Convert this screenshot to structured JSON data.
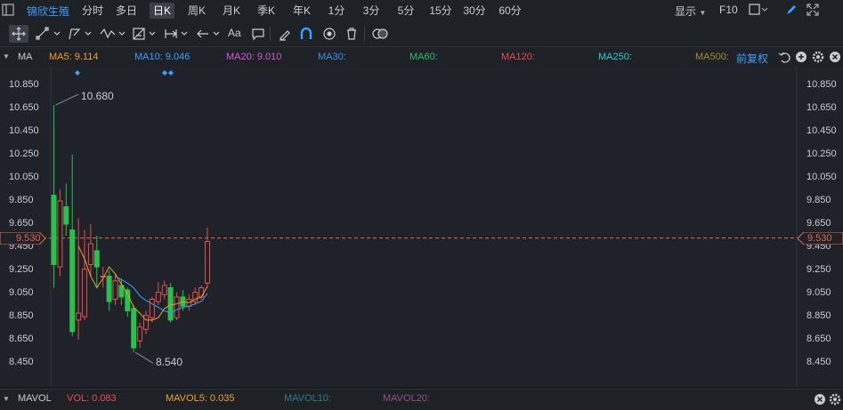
{
  "header": {
    "stock_name": "锦欣生殖",
    "periods": [
      "分时",
      "多日",
      "日K",
      "周K",
      "月K",
      "季K",
      "年K",
      "1分",
      "3分",
      "5分",
      "15分",
      "30分",
      "60分"
    ],
    "active_period": "日K",
    "display_label": "显示",
    "f10_label": "F10"
  },
  "ma_bar": {
    "indicator": "MA",
    "ma5": "MA5: 9.114",
    "ma10": "MA10: 9.046",
    "ma20": "MA20: 9.010",
    "ma30": "MA30:",
    "ma60": "MA60:",
    "ma120": "MA120:",
    "ma250": "MA250:",
    "ma500": "MA500:",
    "adjust": "前复权"
  },
  "colors": {
    "up": "#e84c4c",
    "down": "#27c24c",
    "ma5": "#f0a020",
    "ma10": "#3aa0ff",
    "ma20": "#d05cd0",
    "ma30": "#3a8fe0",
    "ma60": "#2dbe6c",
    "ma120": "#e84c4c",
    "ma250": "#20d0d0",
    "ma500": "#a08a3a",
    "current": "#e06a4a",
    "accent": "#3aa0ff"
  },
  "y_axis": {
    "ticks": [
      "10.850",
      "10.650",
      "10.450",
      "10.250",
      "10.050",
      "9.850",
      "9.650",
      "9.450",
      "9.250",
      "9.050",
      "8.850",
      "8.650",
      "8.450"
    ],
    "current_price": "9.530"
  },
  "annotations": {
    "high": "10.680",
    "low": "8.540"
  },
  "chart_data": {
    "type": "candlestick",
    "ylim": [
      8.35,
      10.93
    ],
    "current_price": 9.53,
    "high": 10.68,
    "low": 8.54,
    "candles": [
      {
        "o": 9.9,
        "c": 9.3,
        "h": 10.68,
        "l": 9.1
      },
      {
        "o": 9.28,
        "c": 9.85,
        "h": 9.95,
        "l": 9.2
      },
      {
        "o": 9.8,
        "c": 9.65,
        "h": 10.0,
        "l": 9.55
      },
      {
        "o": 9.6,
        "c": 8.72,
        "h": 10.25,
        "l": 8.68
      },
      {
        "o": 8.82,
        "c": 8.88,
        "h": 9.7,
        "l": 8.65
      },
      {
        "o": 8.85,
        "c": 9.26,
        "h": 9.6,
        "l": 8.82
      },
      {
        "o": 9.3,
        "c": 9.48,
        "h": 9.65,
        "l": 9.2
      },
      {
        "o": 9.42,
        "c": 9.28,
        "h": 9.55,
        "l": 9.1
      },
      {
        "o": 9.2,
        "c": 9.2,
        "h": 9.28,
        "l": 9.1
      },
      {
        "o": 9.2,
        "c": 8.98,
        "h": 9.25,
        "l": 8.9
      },
      {
        "o": 9.0,
        "c": 9.16,
        "h": 9.22,
        "l": 8.95
      },
      {
        "o": 9.12,
        "c": 9.02,
        "h": 9.18,
        "l": 8.95
      },
      {
        "o": 9.08,
        "c": 8.9,
        "h": 9.1,
        "l": 8.85
      },
      {
        "o": 8.92,
        "c": 8.58,
        "h": 8.95,
        "l": 8.54
      },
      {
        "o": 8.64,
        "c": 8.76,
        "h": 8.8,
        "l": 8.58
      },
      {
        "o": 8.74,
        "c": 8.86,
        "h": 8.9,
        "l": 8.7
      },
      {
        "o": 8.84,
        "c": 9.0,
        "h": 9.02,
        "l": 8.8
      },
      {
        "o": 8.98,
        "c": 9.06,
        "h": 9.15,
        "l": 8.95
      },
      {
        "o": 9.04,
        "c": 9.12,
        "h": 9.16,
        "l": 9.0
      },
      {
        "o": 9.1,
        "c": 8.82,
        "h": 9.14,
        "l": 8.8
      },
      {
        "o": 8.84,
        "c": 9.02,
        "h": 9.06,
        "l": 8.82
      },
      {
        "o": 9.02,
        "c": 8.94,
        "h": 9.08,
        "l": 8.9
      },
      {
        "o": 8.94,
        "c": 9.0,
        "h": 9.04,
        "l": 8.9
      },
      {
        "o": 8.98,
        "c": 9.06,
        "h": 9.1,
        "l": 8.95
      },
      {
        "o": 9.02,
        "c": 9.1,
        "h": 9.12,
        "l": 9.0
      },
      {
        "o": 9.14,
        "c": 9.5,
        "h": 9.62,
        "l": 9.1
      }
    ],
    "ma5": [
      null,
      null,
      null,
      null,
      9.46,
      9.35,
      9.2,
      9.1,
      9.18,
      9.28,
      9.22,
      9.13,
      9.05,
      8.93,
      8.88,
      8.82,
      8.82,
      8.84,
      8.92,
      8.95,
      8.96,
      8.98,
      8.97,
      9.0,
      9.02,
      9.11
    ],
    "ma10": [
      null,
      null,
      null,
      null,
      null,
      null,
      null,
      null,
      null,
      null,
      9.2,
      9.17,
      9.14,
      9.1,
      9.03,
      8.99,
      8.96,
      8.93,
      8.9,
      8.88,
      8.91,
      8.93,
      8.94,
      8.96,
      8.98,
      9.05
    ]
  },
  "vol_bar": {
    "indicator": "MAVOL",
    "vol": "VOL: 0.083",
    "mavol5": "MAVOL5: 0.035",
    "mavol10": "MAVOL10:",
    "mavol20": "MAVOL20:"
  }
}
